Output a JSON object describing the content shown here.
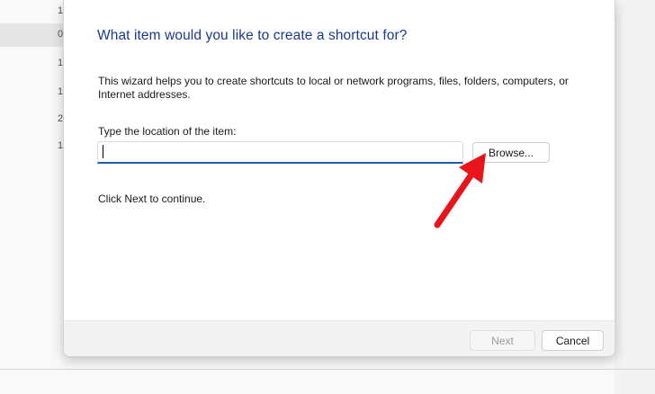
{
  "background": {
    "rows": [
      "1",
      "0",
      "1",
      "1",
      "2",
      "1"
    ]
  },
  "dialog": {
    "title": "What item would you like to create a shortcut for?",
    "description": "This wizard helps you to create shortcuts to local or network programs, files, folders, computers, or Internet addresses.",
    "location_label": "Type the location of the item:",
    "location_value": "",
    "browse_label": "Browse...",
    "continue_text": "Click Next to continue.",
    "next_label": "Next",
    "cancel_label": "Cancel"
  },
  "annotation": {
    "arrow_color": "#e8141b",
    "points_to": "browse-button"
  }
}
